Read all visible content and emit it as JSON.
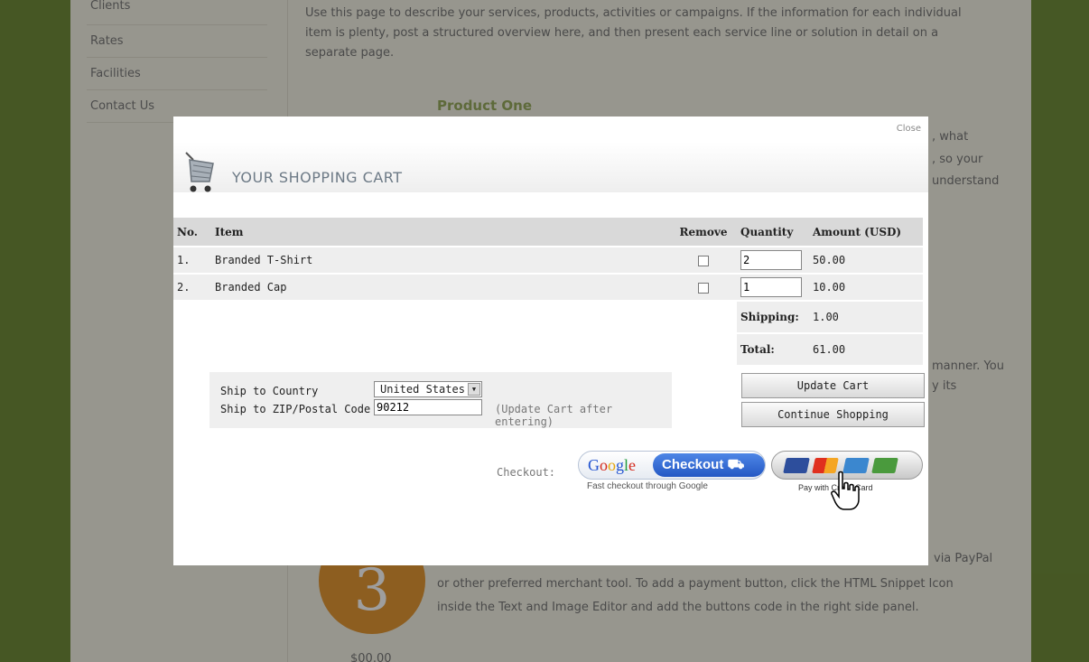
{
  "sidebar": {
    "items": [
      "Clients",
      "Rates",
      "Facilities",
      "Contact Us"
    ]
  },
  "background": {
    "intro": "Use this page to describe your services, products, activities or campaigns. If the information for each individual item is plenty, post a structured overview here, and then present each service line or solution in detail on a separate page.",
    "product_heading": "Product One",
    "fragments": [
      ", what",
      ", so your",
      "understand",
      "manner. You",
      "y its"
    ],
    "step_number": "3",
    "step_text_1": "via PayPal",
    "step_text_2": "or other preferred merchant tool. To add a payment button, click the HTML Snippet Icon",
    "step_text_3": "inside the Text and Image Editor and add the buttons code in the right side panel.",
    "price_fragment": "$00.00"
  },
  "modal": {
    "close_label": "Close",
    "title": "YOUR SHOPPING CART",
    "table": {
      "headers": {
        "no": "No.",
        "item": "Item",
        "remove": "Remove",
        "quantity": "Quantity",
        "amount": "Amount (USD)"
      },
      "rows": [
        {
          "no": "1.",
          "item": "Branded T-Shirt",
          "quantity": "2",
          "amount": "50.00"
        },
        {
          "no": "2.",
          "item": "Branded Cap",
          "quantity": "1",
          "amount": "10.00"
        }
      ],
      "shipping_label": "Shipping:",
      "shipping_value": "1.00",
      "total_label": "Total:",
      "total_value": "61.00"
    },
    "ship": {
      "country_label": "Ship to Country",
      "country_value": "United States",
      "zip_label": "Ship to ZIP/Postal Code",
      "zip_value": "90212",
      "zip_hint": "(Update Cart after entering)"
    },
    "buttons": {
      "update": "Update Cart",
      "continue": "Continue Shopping"
    },
    "checkout": {
      "label": "Checkout:",
      "google_letters": [
        "G",
        "o",
        "o",
        "g",
        "l",
        "e"
      ],
      "google_button": "Checkout",
      "google_sub": "Fast checkout through Google",
      "cc_sub": "Pay with Credit Card",
      "cc_icons": [
        "visa-card-icon",
        "mastercard-icon",
        "amex-card-icon",
        "discover-card-icon"
      ]
    }
  }
}
